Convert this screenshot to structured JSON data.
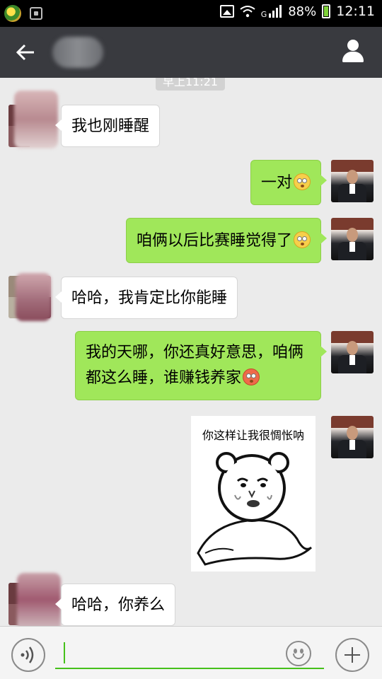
{
  "status_bar": {
    "battery": "88%",
    "time": "12:11",
    "network": "G",
    "icons": [
      "app-notification-icon",
      "screenshot-icon",
      "image-notification-icon",
      "wifi-icon",
      "signal-icon",
      "battery-icon"
    ]
  },
  "header": {
    "back_icon": "arrow-left-icon",
    "title": "",
    "profile_icon": "person-icon"
  },
  "chat": {
    "timestamp": "早上11:21",
    "messages": [
      {
        "side": "left",
        "text": "我也刚睡醒"
      },
      {
        "side": "right",
        "text": "一对",
        "emoji": "flushed-face-emoji"
      },
      {
        "side": "right",
        "text": "咱俩以后比赛睡觉得了",
        "emoji": "flushed-face-emoji"
      },
      {
        "side": "left",
        "text": "哈哈，我肯定比你能睡"
      },
      {
        "side": "right",
        "text": "我的天哪，你还真好意思，咱俩都这么睡，谁赚钱养家",
        "emoji": "red-flushed-face-emoji"
      },
      {
        "side": "right",
        "type": "sticker",
        "caption": "你这样让我很惆怅呐"
      },
      {
        "side": "left",
        "text": "哈哈，你养么"
      }
    ]
  },
  "input_bar": {
    "voice_icon": "voice-icon",
    "text_value": "",
    "emoji_icon": "smiley-icon",
    "plus_icon": "plus-icon",
    "accent_color": "#45c01a"
  },
  "colors": {
    "outgoing_bubble": "#a0e75a",
    "incoming_bubble": "#ffffff",
    "header_bg": "#393a3f",
    "chat_bg": "#ebebeb"
  }
}
